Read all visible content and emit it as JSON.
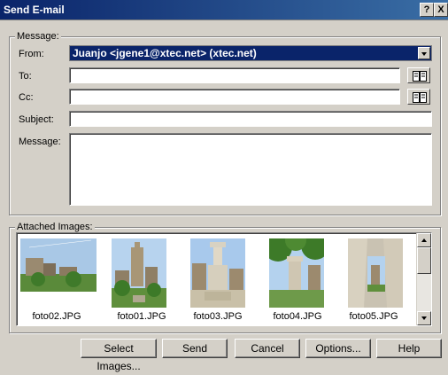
{
  "window": {
    "title": "Send E-mail",
    "help_glyph": "?",
    "close_glyph": "X"
  },
  "message_group": {
    "legend": "Message:",
    "from_label": "From:",
    "from_value": "Juanjo <jgene1@xtec.net> (xtec.net)",
    "to_label": "To:",
    "to_value": "",
    "cc_label": "Cc:",
    "cc_value": "",
    "subject_label": "Subject:",
    "subject_value": "",
    "message_label": "Message:",
    "message_value": ""
  },
  "attachments": {
    "legend": "Attached Images:",
    "items": [
      {
        "filename": "foto02.JPG"
      },
      {
        "filename": "foto01.JPG"
      },
      {
        "filename": "foto03.JPG"
      },
      {
        "filename": "foto04.JPG"
      },
      {
        "filename": "foto05.JPG"
      }
    ]
  },
  "buttons": {
    "select_images": "Select Images...",
    "send": "Send",
    "cancel": "Cancel",
    "options": "Options...",
    "help": "Help"
  },
  "colors": {
    "titlebar": "#0a246a",
    "face": "#d4d0c8",
    "selection": "#0a246a"
  }
}
